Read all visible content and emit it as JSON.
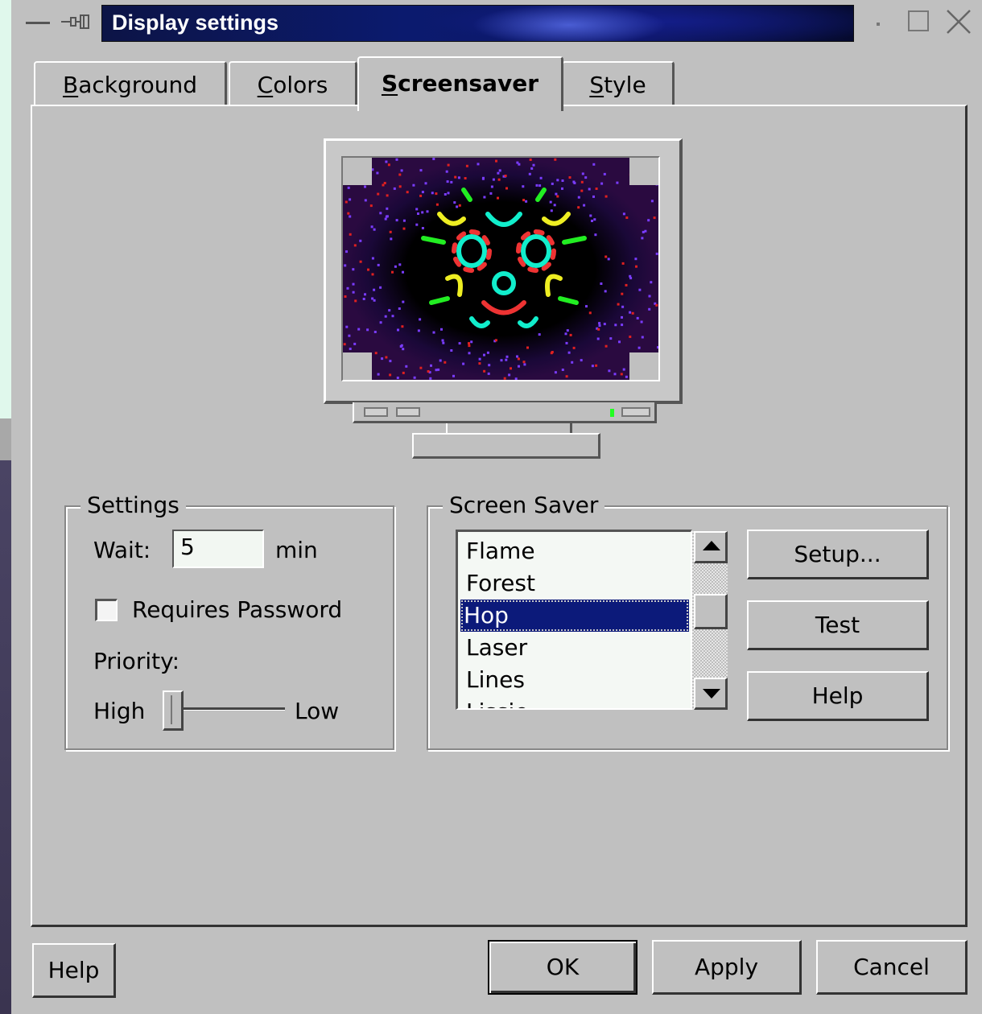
{
  "window": {
    "title": "Display settings"
  },
  "tabs": [
    {
      "label": "Background",
      "mnemonic": "B",
      "rest": "ackground",
      "active": false
    },
    {
      "label": "Colors",
      "mnemonic": "C",
      "rest": "olors",
      "active": false
    },
    {
      "label": "Screensaver",
      "mnemonic": "S",
      "rest": "creensaver",
      "active": true
    },
    {
      "label": "Style",
      "mnemonic": "S",
      "rest": "tyle",
      "active": false
    }
  ],
  "settings": {
    "group_title": "Settings",
    "wait_label": "Wait:",
    "wait_value": "5",
    "wait_unit": "min",
    "requires_password_label": "Requires Password",
    "requires_password_checked": false,
    "priority_label": "Priority:",
    "priority_high": "High",
    "priority_low": "Low",
    "priority_level": 0
  },
  "screen_saver": {
    "group_title": "Screen Saver",
    "items": [
      "Flame",
      "Forest",
      "Hop",
      "Laser",
      "Lines",
      "Lissie"
    ],
    "selected": "Hop",
    "setup_label": "Setup...",
    "test_label": "Test",
    "help_label": "Help"
  },
  "footer": {
    "help_label": "Help",
    "ok_label": "OK",
    "apply_label": "Apply",
    "cancel_label": "Cancel"
  },
  "colors": {
    "title_bar": "#0b1a6e",
    "selection": "#0c1a7a",
    "dialog": "#c0c0c0"
  },
  "icons": {
    "window_menu": "menu-dash-icon",
    "pin": "pin-icon",
    "minimize": "minimize-dot-icon",
    "maximize": "maximize-icon",
    "close": "close-icon"
  }
}
